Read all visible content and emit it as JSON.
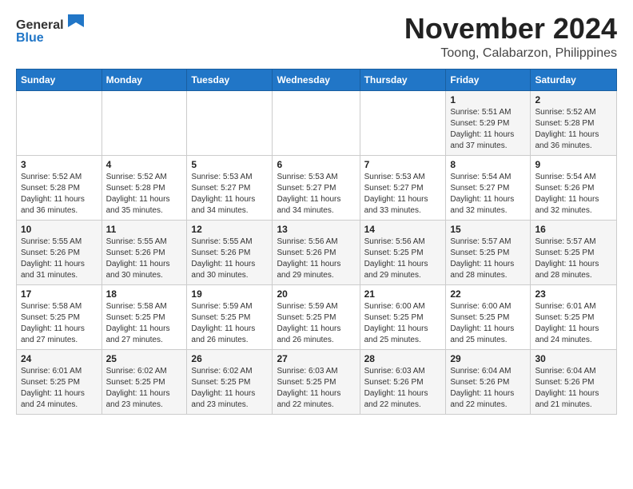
{
  "header": {
    "logo_general": "General",
    "logo_blue": "Blue",
    "main_title": "November 2024",
    "subtitle": "Toong, Calabarzon, Philippines"
  },
  "calendar": {
    "days_of_week": [
      "Sunday",
      "Monday",
      "Tuesday",
      "Wednesday",
      "Thursday",
      "Friday",
      "Saturday"
    ],
    "weeks": [
      [
        {
          "day": "",
          "info": ""
        },
        {
          "day": "",
          "info": ""
        },
        {
          "day": "",
          "info": ""
        },
        {
          "day": "",
          "info": ""
        },
        {
          "day": "",
          "info": ""
        },
        {
          "day": "1",
          "info": "Sunrise: 5:51 AM\nSunset: 5:29 PM\nDaylight: 11 hours and 37 minutes."
        },
        {
          "day": "2",
          "info": "Sunrise: 5:52 AM\nSunset: 5:28 PM\nDaylight: 11 hours and 36 minutes."
        }
      ],
      [
        {
          "day": "3",
          "info": "Sunrise: 5:52 AM\nSunset: 5:28 PM\nDaylight: 11 hours and 36 minutes."
        },
        {
          "day": "4",
          "info": "Sunrise: 5:52 AM\nSunset: 5:28 PM\nDaylight: 11 hours and 35 minutes."
        },
        {
          "day": "5",
          "info": "Sunrise: 5:53 AM\nSunset: 5:27 PM\nDaylight: 11 hours and 34 minutes."
        },
        {
          "day": "6",
          "info": "Sunrise: 5:53 AM\nSunset: 5:27 PM\nDaylight: 11 hours and 34 minutes."
        },
        {
          "day": "7",
          "info": "Sunrise: 5:53 AM\nSunset: 5:27 PM\nDaylight: 11 hours and 33 minutes."
        },
        {
          "day": "8",
          "info": "Sunrise: 5:54 AM\nSunset: 5:27 PM\nDaylight: 11 hours and 32 minutes."
        },
        {
          "day": "9",
          "info": "Sunrise: 5:54 AM\nSunset: 5:26 PM\nDaylight: 11 hours and 32 minutes."
        }
      ],
      [
        {
          "day": "10",
          "info": "Sunrise: 5:55 AM\nSunset: 5:26 PM\nDaylight: 11 hours and 31 minutes."
        },
        {
          "day": "11",
          "info": "Sunrise: 5:55 AM\nSunset: 5:26 PM\nDaylight: 11 hours and 30 minutes."
        },
        {
          "day": "12",
          "info": "Sunrise: 5:55 AM\nSunset: 5:26 PM\nDaylight: 11 hours and 30 minutes."
        },
        {
          "day": "13",
          "info": "Sunrise: 5:56 AM\nSunset: 5:26 PM\nDaylight: 11 hours and 29 minutes."
        },
        {
          "day": "14",
          "info": "Sunrise: 5:56 AM\nSunset: 5:25 PM\nDaylight: 11 hours and 29 minutes."
        },
        {
          "day": "15",
          "info": "Sunrise: 5:57 AM\nSunset: 5:25 PM\nDaylight: 11 hours and 28 minutes."
        },
        {
          "day": "16",
          "info": "Sunrise: 5:57 AM\nSunset: 5:25 PM\nDaylight: 11 hours and 28 minutes."
        }
      ],
      [
        {
          "day": "17",
          "info": "Sunrise: 5:58 AM\nSunset: 5:25 PM\nDaylight: 11 hours and 27 minutes."
        },
        {
          "day": "18",
          "info": "Sunrise: 5:58 AM\nSunset: 5:25 PM\nDaylight: 11 hours and 27 minutes."
        },
        {
          "day": "19",
          "info": "Sunrise: 5:59 AM\nSunset: 5:25 PM\nDaylight: 11 hours and 26 minutes."
        },
        {
          "day": "20",
          "info": "Sunrise: 5:59 AM\nSunset: 5:25 PM\nDaylight: 11 hours and 26 minutes."
        },
        {
          "day": "21",
          "info": "Sunrise: 6:00 AM\nSunset: 5:25 PM\nDaylight: 11 hours and 25 minutes."
        },
        {
          "day": "22",
          "info": "Sunrise: 6:00 AM\nSunset: 5:25 PM\nDaylight: 11 hours and 25 minutes."
        },
        {
          "day": "23",
          "info": "Sunrise: 6:01 AM\nSunset: 5:25 PM\nDaylight: 11 hours and 24 minutes."
        }
      ],
      [
        {
          "day": "24",
          "info": "Sunrise: 6:01 AM\nSunset: 5:25 PM\nDaylight: 11 hours and 24 minutes."
        },
        {
          "day": "25",
          "info": "Sunrise: 6:02 AM\nSunset: 5:25 PM\nDaylight: 11 hours and 23 minutes."
        },
        {
          "day": "26",
          "info": "Sunrise: 6:02 AM\nSunset: 5:25 PM\nDaylight: 11 hours and 23 minutes."
        },
        {
          "day": "27",
          "info": "Sunrise: 6:03 AM\nSunset: 5:25 PM\nDaylight: 11 hours and 22 minutes."
        },
        {
          "day": "28",
          "info": "Sunrise: 6:03 AM\nSunset: 5:26 PM\nDaylight: 11 hours and 22 minutes."
        },
        {
          "day": "29",
          "info": "Sunrise: 6:04 AM\nSunset: 5:26 PM\nDaylight: 11 hours and 22 minutes."
        },
        {
          "day": "30",
          "info": "Sunrise: 6:04 AM\nSunset: 5:26 PM\nDaylight: 11 hours and 21 minutes."
        }
      ]
    ]
  }
}
